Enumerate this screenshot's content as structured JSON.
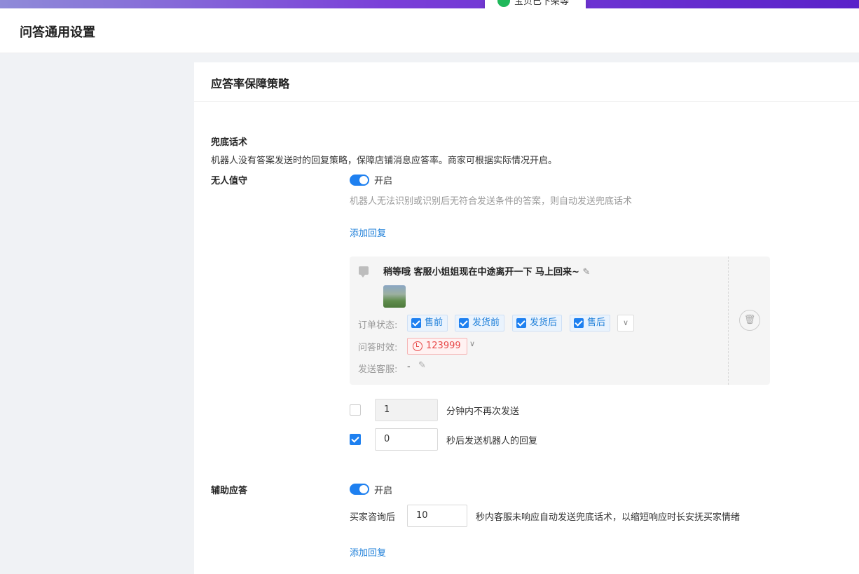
{
  "top_toast": {
    "text": "宝贝已下架等"
  },
  "header": {
    "title": "问答通用设置"
  },
  "card": {
    "title": "应答率保障策略"
  },
  "fallback": {
    "section_title": "兜底话术",
    "section_desc": "机器人没有答案发送时的回复策略，保障店铺消息应答率。商家可根据实际情况开启。",
    "unattended": {
      "label": "无人值守",
      "switch_on": true,
      "switch_label": "开启",
      "hint": "机器人无法识别或识别后无符合发送条件的答案，则自动发送兜底话术",
      "add_reply": "添加回复"
    },
    "reply": {
      "text": "稍等哦 客服小姐姐现在中途离开一下 马上回来~",
      "order_status_label": "订单状态:",
      "order_status_tags": [
        "售前",
        "发货前",
        "发货后",
        "售后"
      ],
      "time_label": "问答时效:",
      "time_value": "123999",
      "agent_label": "发送客服:",
      "agent_value": "-"
    },
    "rule1": {
      "checked": false,
      "value": "1",
      "suffix": "分钟内不再次发送"
    },
    "rule2": {
      "checked": true,
      "value": "0",
      "suffix": "秒后发送机器人的回复"
    }
  },
  "assist": {
    "label": "辅助应答",
    "switch_on": true,
    "switch_label": "开启",
    "prefix": "买家咨询后",
    "value": "10",
    "suffix": "秒内客服未响应自动发送兜底话术，以缩短响应时长安抚买家情绪",
    "add_reply": "添加回复"
  },
  "colors": {
    "accent": "#1e80f0",
    "link": "#1e7fd9",
    "danger": "#e84a4a"
  }
}
